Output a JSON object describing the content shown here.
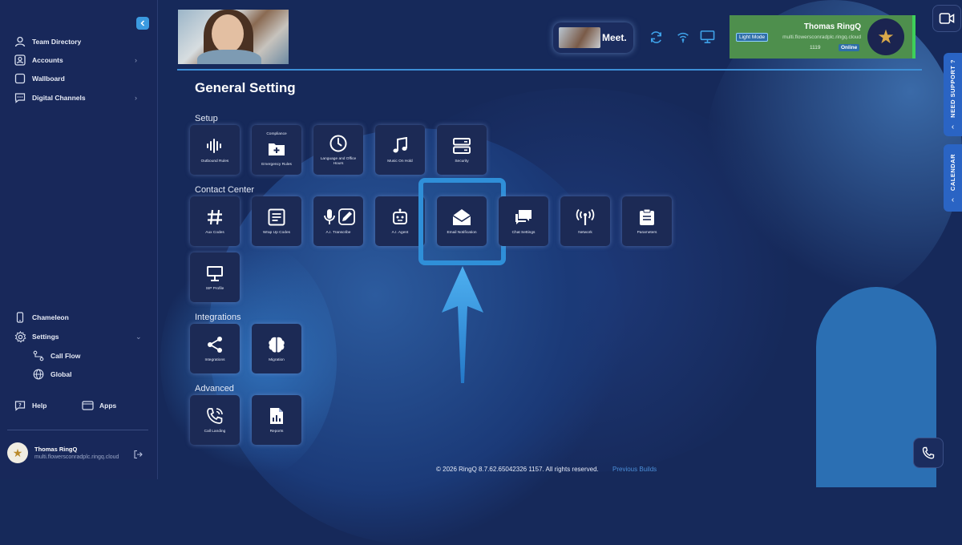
{
  "sidebar": {
    "collapse_icon": "chevron-left-icon",
    "items": [
      {
        "label": "Team Directory",
        "icon": "user-icon"
      },
      {
        "label": "Accounts",
        "icon": "user-square-icon"
      },
      {
        "label": "Wallboard",
        "icon": "square-icon"
      },
      {
        "label": "Digital Channels",
        "icon": "chat-icon"
      }
    ],
    "bottom_items": [
      {
        "label": "Chameleon",
        "icon": "phone-device-icon"
      },
      {
        "label": "Settings",
        "icon": "gear-icon"
      }
    ],
    "settings_sub": [
      {
        "label": "Call Flow",
        "icon": "flow-icon"
      },
      {
        "label": "Global",
        "icon": "globe-icon"
      }
    ],
    "help_label": "Help",
    "apps_label": "Apps",
    "user": {
      "name": "Thomas RingQ",
      "domain": "multi.flowersconradplc.ringq.cloud"
    }
  },
  "header": {
    "meet_label": "Meet.",
    "profile": {
      "name": "Thomas RingQ",
      "mode_badge": "Light Mode",
      "domain": "multi.flowersconradplc.ringq.cloud",
      "extension": "1119",
      "status": "Online"
    }
  },
  "side_tabs": {
    "support": "NEED SUPPORT ?",
    "calendar": "CALENDAR"
  },
  "main": {
    "title": "General Setting",
    "sections": {
      "setup": "Setup",
      "contact_center": "Contact Center",
      "integrations": "Integrations",
      "advanced": "Advanced"
    },
    "tiles": {
      "outbound_rules": "Outbound Rules",
      "compliance_top": "Compliance",
      "emergency_rules": "Emergency Rules",
      "language_office": "Language and Office Hours",
      "music_on_hold": "Music On Hold",
      "security": "Security",
      "aux_codes": "Aux Codes",
      "wrap_up_codes": "Wrap Up Codes",
      "ai_transcribe": "A.I. Transcribe",
      "ai_agent": "A.I. Agent",
      "email_notification": "Email Notification",
      "chat_settings": "Chat Settings",
      "network": "Network",
      "parameters": "Parameters",
      "sip_profile": "SIP Profile",
      "integrations": "Integrations",
      "migration": "Migration",
      "call_landing": "Call Landing",
      "reports": "Reports"
    }
  },
  "footer": {
    "copyright": "© 2026 RingQ 8.7.62.65042326 1157. All rights reserved.",
    "previous_builds": "Previous Builds"
  },
  "colors": {
    "background": "#16295a",
    "accent": "#2f8fd8",
    "profile_green": "#4e8f4d",
    "online_bar": "#3ed05a"
  }
}
